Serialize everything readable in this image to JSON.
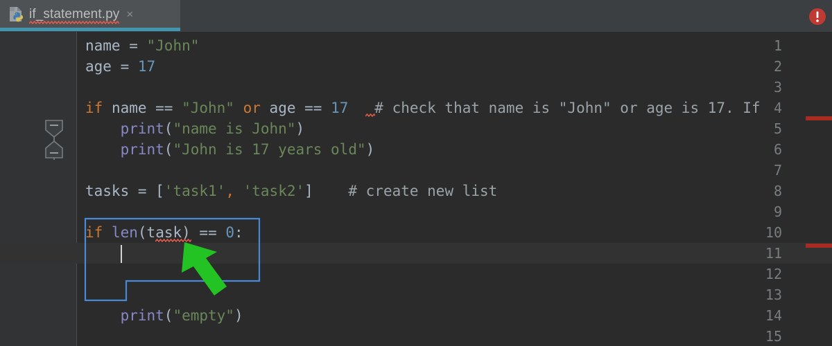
{
  "window": {
    "theme": "darcula",
    "colors": {
      "editor_bg": "#2b2b2b",
      "gutter_bg": "#313335",
      "tabbar_bg": "#3c3f41",
      "active_tab_bg": "#4e5254",
      "tab_underline": "#4396b0",
      "keyword": "#cc7832",
      "string": "#6a8759",
      "number": "#6897bb",
      "function": "#9876aa",
      "builtin": "#8888c6",
      "comment": "#9ba3a8",
      "identifier": "#a9b7c6",
      "error_red": "#cc3333",
      "selection_outline": "#4a88d8",
      "arrow_green": "#22c322",
      "caret": "#d4d4d4",
      "current_line_bg": "#323232"
    }
  },
  "tab": {
    "filename": "if_statement.py",
    "icon": "python-file-icon",
    "close_label": "×",
    "has_error_squiggle": true,
    "active": true
  },
  "editor": {
    "line_numbers": [
      "1",
      "2",
      "3",
      "4",
      "5",
      "6",
      "7",
      "8",
      "9",
      "10",
      "11",
      "12",
      "13",
      "14",
      "15"
    ],
    "lines": [
      {
        "n": 1,
        "text": "name = \"John\"",
        "tokens": [
          {
            "t": "name",
            "c": "id"
          },
          {
            "t": " = ",
            "c": "op"
          },
          {
            "t": "\"John\"",
            "c": "str"
          }
        ]
      },
      {
        "n": 2,
        "text": "age = 17",
        "tokens": [
          {
            "t": "age",
            "c": "id"
          },
          {
            "t": " = ",
            "c": "op"
          },
          {
            "t": "17",
            "c": "num"
          }
        ]
      },
      {
        "n": 3,
        "text": "",
        "tokens": []
      },
      {
        "n": 4,
        "text": "if name == \"John\" or age == 17  # check that name is \"John\" or age is 17. If",
        "tokens": [
          {
            "t": "if",
            "c": "kw"
          },
          {
            "t": " name ",
            "c": "id"
          },
          {
            "t": "== ",
            "c": "op"
          },
          {
            "t": "\"John\"",
            "c": "str"
          },
          {
            "t": " ",
            "c": "op"
          },
          {
            "t": "or",
            "c": "kw"
          },
          {
            "t": " age ",
            "c": "id"
          },
          {
            "t": "== ",
            "c": "op"
          },
          {
            "t": "17",
            "c": "num"
          },
          {
            "t": "   # check that name is \"John\" or age is 17. If",
            "c": "com"
          }
        ]
      },
      {
        "n": 5,
        "text": "    print(\"name is John\")",
        "tokens": [
          {
            "t": "    ",
            "c": "op"
          },
          {
            "t": "print",
            "c": "bfn"
          },
          {
            "t": "(",
            "c": "op"
          },
          {
            "t": "\"name is John\"",
            "c": "str"
          },
          {
            "t": ")",
            "c": "op"
          }
        ]
      },
      {
        "n": 6,
        "text": "    print(\"John is 17 years old\")",
        "tokens": [
          {
            "t": "    ",
            "c": "op"
          },
          {
            "t": "print",
            "c": "bfn"
          },
          {
            "t": "(",
            "c": "op"
          },
          {
            "t": "\"John is 17 years old\"",
            "c": "str"
          },
          {
            "t": ")",
            "c": "op"
          }
        ]
      },
      {
        "n": 7,
        "text": "",
        "tokens": []
      },
      {
        "n": 8,
        "text": "tasks = ['task1', 'task2']    # create new list",
        "tokens": [
          {
            "t": "tasks",
            "c": "id"
          },
          {
            "t": " = [",
            "c": "op"
          },
          {
            "t": "'task1'",
            "c": "str"
          },
          {
            "t": ",",
            "c": "kw"
          },
          {
            "t": " ",
            "c": "op"
          },
          {
            "t": "'task2'",
            "c": "str"
          },
          {
            "t": "]",
            "c": "op"
          },
          {
            "t": "    # create new list",
            "c": "com"
          }
        ]
      },
      {
        "n": 9,
        "text": "",
        "tokens": []
      },
      {
        "n": 10,
        "text": "if len(task) == 0:",
        "tokens": [
          {
            "t": "if",
            "c": "kw"
          },
          {
            "t": " ",
            "c": "op"
          },
          {
            "t": "len",
            "c": "bfn"
          },
          {
            "t": "(",
            "c": "op"
          },
          {
            "t": "task",
            "c": "id"
          },
          {
            "t": ") ",
            "c": "op"
          },
          {
            "t": "== ",
            "c": "op"
          },
          {
            "t": "0",
            "c": "num"
          },
          {
            "t": ":",
            "c": "op"
          }
        ]
      },
      {
        "n": 11,
        "text": "    ",
        "tokens": []
      },
      {
        "n": 12,
        "text": "",
        "tokens": []
      },
      {
        "n": 13,
        "text": "",
        "tokens": []
      },
      {
        "n": 14,
        "text": "    print(\"empty\")",
        "tokens": [
          {
            "t": "    ",
            "c": "op"
          },
          {
            "t": "print",
            "c": "bfn"
          },
          {
            "t": "(",
            "c": "op"
          },
          {
            "t": "\"empty\"",
            "c": "str"
          },
          {
            "t": ")",
            "c": "op"
          }
        ]
      },
      {
        "n": 15,
        "text": "",
        "tokens": []
      }
    ],
    "caret_line": 11,
    "current_line": 11,
    "fold_markers": [
      {
        "line": 5,
        "type": "fold-collapse-start"
      },
      {
        "line": 6,
        "type": "fold-collapse-end"
      }
    ],
    "error_squiggles": [
      {
        "line": 4,
        "label": "17"
      },
      {
        "line": 10,
        "label": "task"
      }
    ],
    "selection_outline": {
      "shape": "step",
      "lines": "10-13",
      "color": "#4a88d8"
    }
  },
  "annotations": {
    "arrow": {
      "name": "green-arrow-pointer",
      "color": "#22c322",
      "points_at": "task"
    }
  },
  "inspections": {
    "badge": "error-badge",
    "badge_symbol": "!",
    "stripe_lines": [
      4,
      11
    ]
  }
}
